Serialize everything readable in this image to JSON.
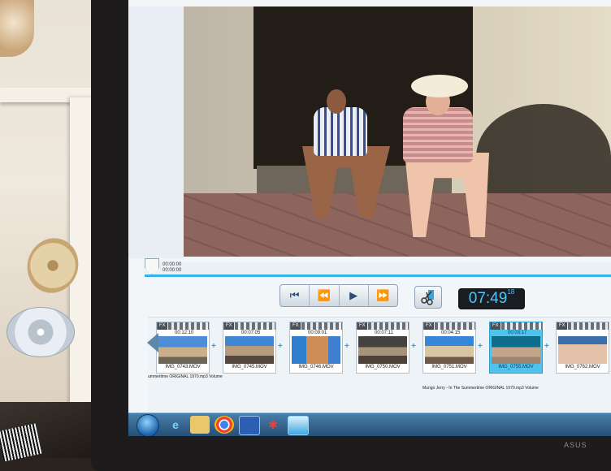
{
  "scrub": {
    "time_top": "00:00:00",
    "time_bottom": "00:00:00"
  },
  "transport": {
    "prev": "⏮",
    "rewind": "⏪",
    "play": "▶",
    "forward": "⏩"
  },
  "timecode": {
    "main": "07:49",
    "frames": "18"
  },
  "clips": [
    {
      "badge": "FX",
      "duration": "00:12:10",
      "name": "IMG_0743.MOV",
      "selected": false
    },
    {
      "badge": "FX",
      "duration": "00:07:05",
      "name": "IMG_0745.MOV",
      "selected": false
    },
    {
      "badge": "FX",
      "duration": "00:09:01",
      "name": "IMG_0746.MOV",
      "selected": false
    },
    {
      "badge": "FX",
      "duration": "00:07:11",
      "name": "IMG_0750.MOV",
      "selected": false
    },
    {
      "badge": "FX",
      "duration": "00:04:15",
      "name": "IMG_0751.MOV",
      "selected": false
    },
    {
      "badge": "FX",
      "duration": "00:03:17",
      "name": "IMG_0755.MOV",
      "selected": true
    },
    {
      "badge": "FX",
      "duration": "",
      "name": "IMG_0762.MOV",
      "selected": false
    }
  ],
  "audio": {
    "track1": "ummertime ORIGINAL 1970.mp3   Volume",
    "track2": "Mungo Jerry - In The Summertime ORIGINAL 1970.mp3   Volume"
  },
  "monitor_brand": "ASUS",
  "colors": {
    "accent": "#33b4e4",
    "timecode": "#4cc7ff",
    "selected_clip": "#4fc3ec"
  }
}
